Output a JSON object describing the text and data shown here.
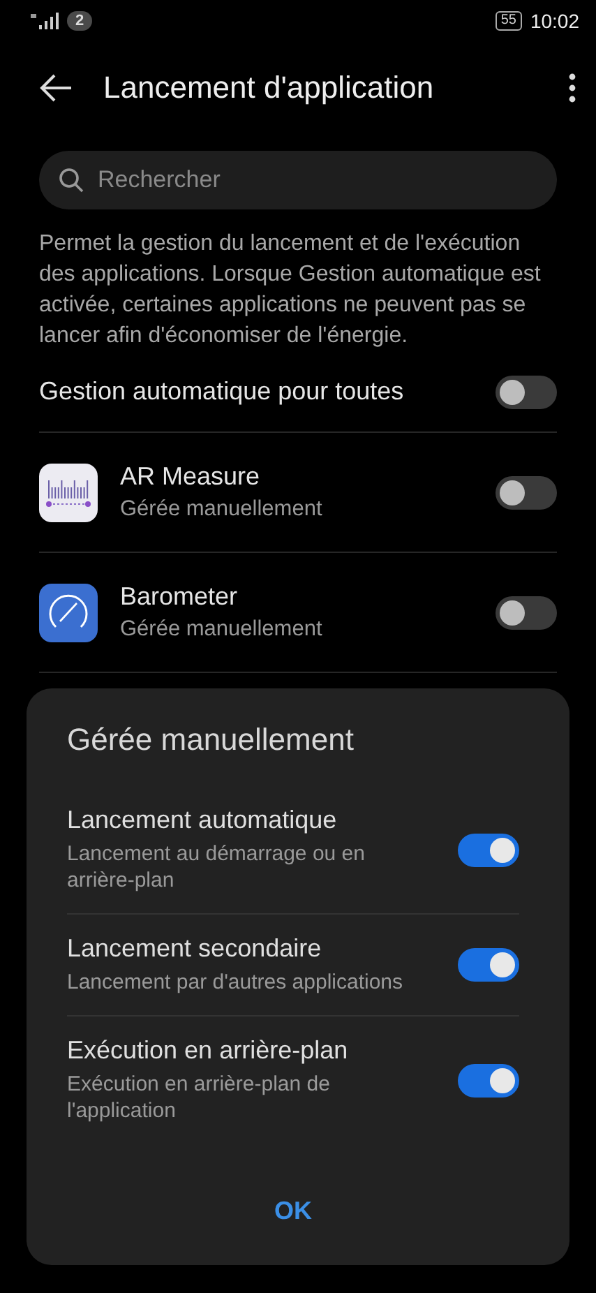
{
  "status_bar": {
    "notification_count": "2",
    "battery": "55",
    "time": "10:02"
  },
  "header": {
    "title": "Lancement d'application"
  },
  "search": {
    "placeholder": "Rechercher"
  },
  "description": "Permet la gestion du lancement et de l'exécution des applications. Lorsque Gestion automatique est activée, certaines applications ne peuvent pas se lancer afin d'économiser de l'énergie.",
  "master_toggle": {
    "label": "Gestion automatique pour toutes",
    "on": false
  },
  "apps": [
    {
      "kind": "ruler",
      "name": "AR Measure",
      "status": "Gérée manuellement",
      "on": false
    },
    {
      "kind": "gauge",
      "name": "Barometer",
      "status": "Gérée manuellement",
      "on": false
    }
  ],
  "dialog": {
    "title": "Gérée manuellement",
    "options": [
      {
        "label": "Lancement automatique",
        "description": "Lancement au démarrage ou en arrière-plan",
        "on": true
      },
      {
        "label": "Lancement secondaire",
        "description": "Lancement par d'autres applications",
        "on": true
      },
      {
        "label": "Exécution en arrière-plan",
        "description": "Exécution en arrière-plan de l'application",
        "on": true
      }
    ],
    "button": "OK"
  }
}
